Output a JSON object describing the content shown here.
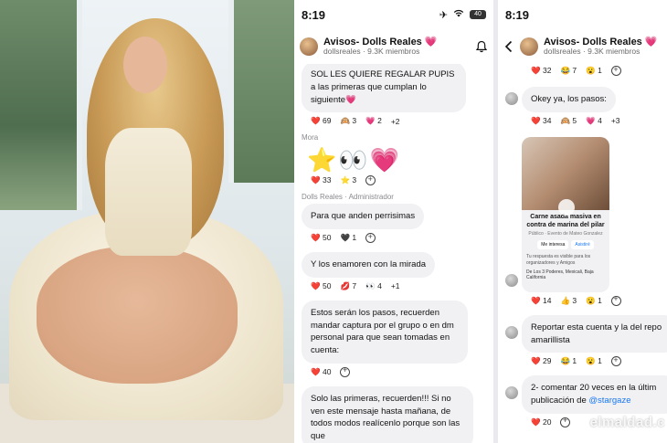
{
  "photo": {
    "alt": ""
  },
  "phone1": {
    "time": "8:19",
    "battery": "40",
    "channel_title": "Avisos- Dolls Reales",
    "channel_title_emoji": "💗",
    "members": "dollsreales · 9.3K miembros",
    "messages": [
      {
        "text": "SOL LES QUIERE REGALAR PUPIS a las primeras que cumplan lo siguiente💗",
        "reactions": [
          {
            "e": "❤️",
            "n": "69"
          },
          {
            "e": "🙉",
            "n": "3"
          },
          {
            "e": "💗",
            "n": "2"
          },
          {
            "e": "",
            "n": "+2"
          }
        ]
      },
      {
        "sender": "Mora",
        "emojis": "⭐👀💗",
        "reactions": [
          {
            "e": "❤️",
            "n": "33"
          },
          {
            "e": "⭐",
            "n": "3"
          }
        ]
      },
      {
        "sender": "Dolls Reales · Administrador",
        "text": "Para que anden perrisimas",
        "reactions": [
          {
            "e": "❤️",
            "n": "50"
          },
          {
            "e": "🖤",
            "n": "1"
          }
        ]
      },
      {
        "text": "Y los enamoren con la mirada",
        "reactions": [
          {
            "e": "❤️",
            "n": "50"
          },
          {
            "e": "💋",
            "n": "7"
          },
          {
            "e": "👀",
            "n": "4"
          },
          {
            "e": "",
            "n": "+1"
          }
        ]
      },
      {
        "text": "Estos serán los pasos, recuerden mandar captura por el grupo o en dm personal para que sean tomadas en cuenta:",
        "reactions": [
          {
            "e": "❤️",
            "n": "40"
          }
        ]
      },
      {
        "text": "Solo las primeras, recuerden!!! Si no ven este mensaje hasta mañana, de todos modos realícenlo porque son las que"
      }
    ]
  },
  "phone2": {
    "time": "8:19",
    "channel_title": "Avisos- Dolls Reales",
    "channel_title_emoji": "💗",
    "members": "dollsreales · 9.3K miembros",
    "top_reactions": [
      {
        "e": "❤️",
        "n": "32"
      },
      {
        "e": "😂",
        "n": "7"
      },
      {
        "e": "😮",
        "n": "1"
      }
    ],
    "messages": [
      {
        "text": "Okey ya, los pasos:",
        "reactions": [
          {
            "e": "❤️",
            "n": "34"
          },
          {
            "e": "🙉",
            "n": "5"
          },
          {
            "e": "💗",
            "n": "4"
          },
          {
            "e": "",
            "n": "+3"
          }
        ]
      },
      {
        "card": {
          "title": "Carne asada masiva en contra de marina del pilar",
          "meta": "Público · Evento de Mateo Gonzalez",
          "btn1": "Me interesa",
          "btn2": "Asistiré",
          "note": "Tu respuesta es visible para los organizadores y Amigos",
          "addr": "De Los 3 Poderes, Mexicali, Baja California"
        },
        "reactions": [
          {
            "e": "❤️",
            "n": "14"
          },
          {
            "e": "👍",
            "n": "3"
          },
          {
            "e": "😮",
            "n": "1"
          }
        ]
      },
      {
        "text": "Reportar esta cuenta y la del repo amarillista",
        "reactions": [
          {
            "e": "❤️",
            "n": "29"
          },
          {
            "e": "😂",
            "n": "1"
          },
          {
            "e": "😮",
            "n": "1"
          }
        ]
      },
      {
        "text_pre": "2- comentar 20 veces en la últim publicación de ",
        "mention": "@stargaze",
        "reactions": [
          {
            "e": "❤️",
            "n": "20"
          }
        ]
      }
    ],
    "watermark": "elmaldad.c"
  }
}
